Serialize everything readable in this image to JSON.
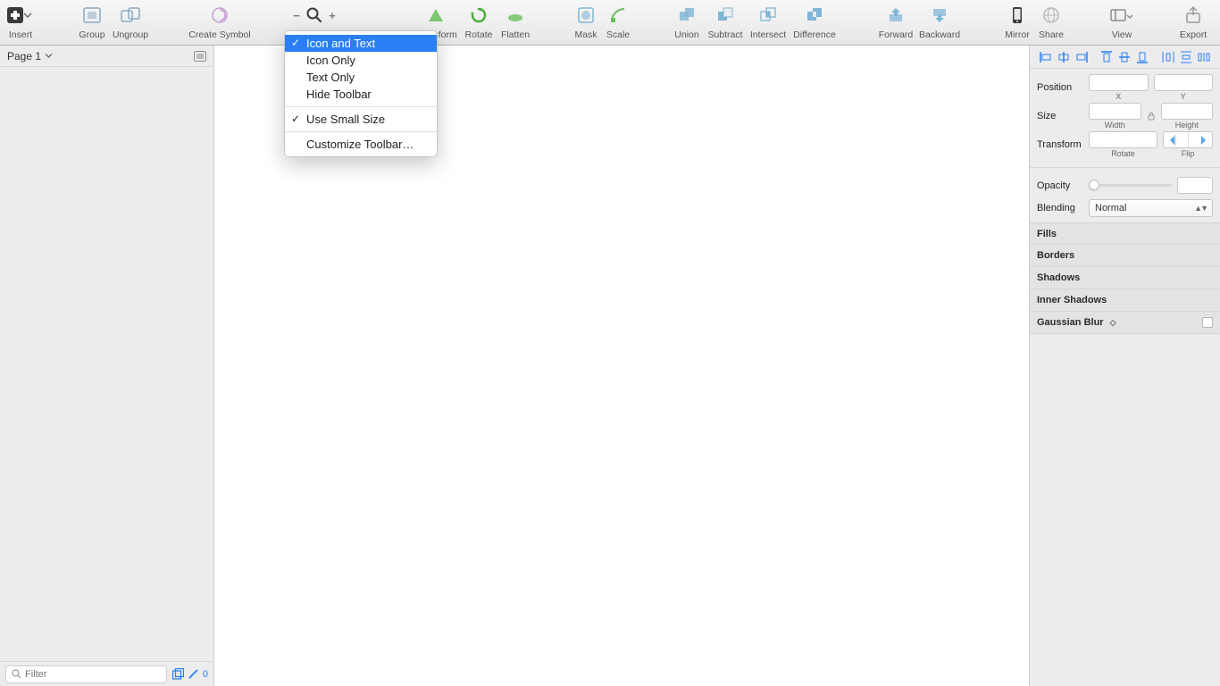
{
  "toolbar": {
    "insert": "Insert",
    "group": "Group",
    "ungroup": "Ungroup",
    "create_symbol": "Create Symbol",
    "transform": "Transform",
    "rotate": "Rotate",
    "flatten": "Flatten",
    "mask": "Mask",
    "scale": "Scale",
    "union": "Union",
    "subtract": "Subtract",
    "intersect": "Intersect",
    "difference": "Difference",
    "forward": "Forward",
    "backward": "Backward",
    "mirror": "Mirror",
    "share": "Share",
    "view": "View",
    "export": "Export"
  },
  "context_menu": {
    "icon_and_text": "Icon and Text",
    "icon_only": "Icon Only",
    "text_only": "Text Only",
    "hide_toolbar": "Hide Toolbar",
    "use_small_size": "Use Small Size",
    "customize": "Customize Toolbar…"
  },
  "left": {
    "page_label": "Page 1",
    "filter_placeholder": "Filter",
    "count": "0"
  },
  "inspector": {
    "position": "Position",
    "x": "X",
    "y": "Y",
    "size": "Size",
    "width": "Width",
    "height": "Height",
    "transform": "Transform",
    "rotate_lbl": "Rotate",
    "flip_lbl": "Flip",
    "opacity": "Opacity",
    "blending": "Blending",
    "blending_value": "Normal",
    "fills": "Fills",
    "borders": "Borders",
    "shadows": "Shadows",
    "inner_shadows": "Inner Shadows",
    "gaussian_blur": "Gaussian Blur"
  }
}
